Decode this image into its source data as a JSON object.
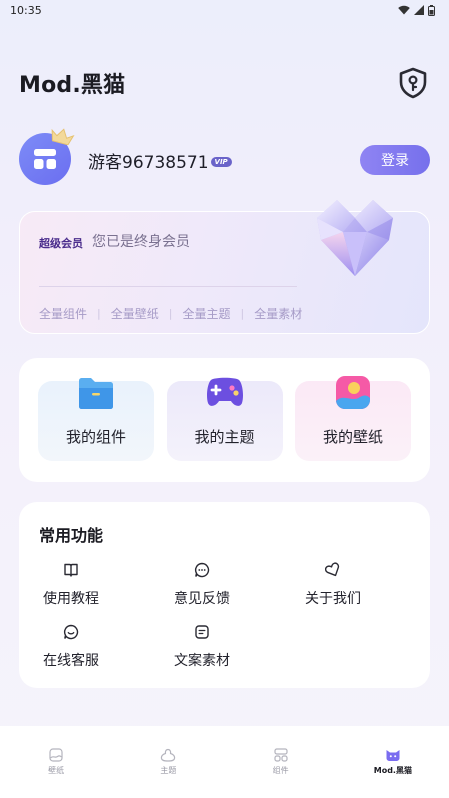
{
  "status_bar": {
    "time": "10:35"
  },
  "header": {
    "title": "Mod.黑猫",
    "shield_icon": "shield-key-icon"
  },
  "profile": {
    "username": "游客96738571",
    "vip_tag": "VIP",
    "login_label": "登录"
  },
  "vip_card": {
    "badge": "超级会员",
    "status": "您已是终身会员",
    "features": [
      "全量组件",
      "全量壁纸",
      "全量主题",
      "全量素材"
    ]
  },
  "quick_actions": [
    {
      "label": "我的组件",
      "icon": "folder-icon"
    },
    {
      "label": "我的主题",
      "icon": "gamepad-icon"
    },
    {
      "label": "我的壁纸",
      "icon": "picture-icon"
    }
  ],
  "functions": {
    "title": "常用功能",
    "items": [
      {
        "label": "使用教程",
        "icon": "book-icon"
      },
      {
        "label": "意见反馈",
        "icon": "chat-bubble-icon"
      },
      {
        "label": "关于我们",
        "icon": "heart-icon"
      },
      {
        "label": "在线客服",
        "icon": "support-chat-icon"
      },
      {
        "label": "文案素材",
        "icon": "document-icon"
      }
    ]
  },
  "tabbar": {
    "active": "Mod.黑猫",
    "tabs": [
      {
        "label": "壁纸",
        "icon": "wallpaper-icon"
      },
      {
        "label": "主题",
        "icon": "theme-icon"
      },
      {
        "label": "组件",
        "icon": "widget-icon"
      },
      {
        "label": "Mod.黑猫",
        "icon": "cat-icon"
      }
    ]
  },
  "colors": {
    "accent": "#7670ec",
    "vip_text": "#4a2c8c",
    "feature_text": "#a69bc7"
  }
}
